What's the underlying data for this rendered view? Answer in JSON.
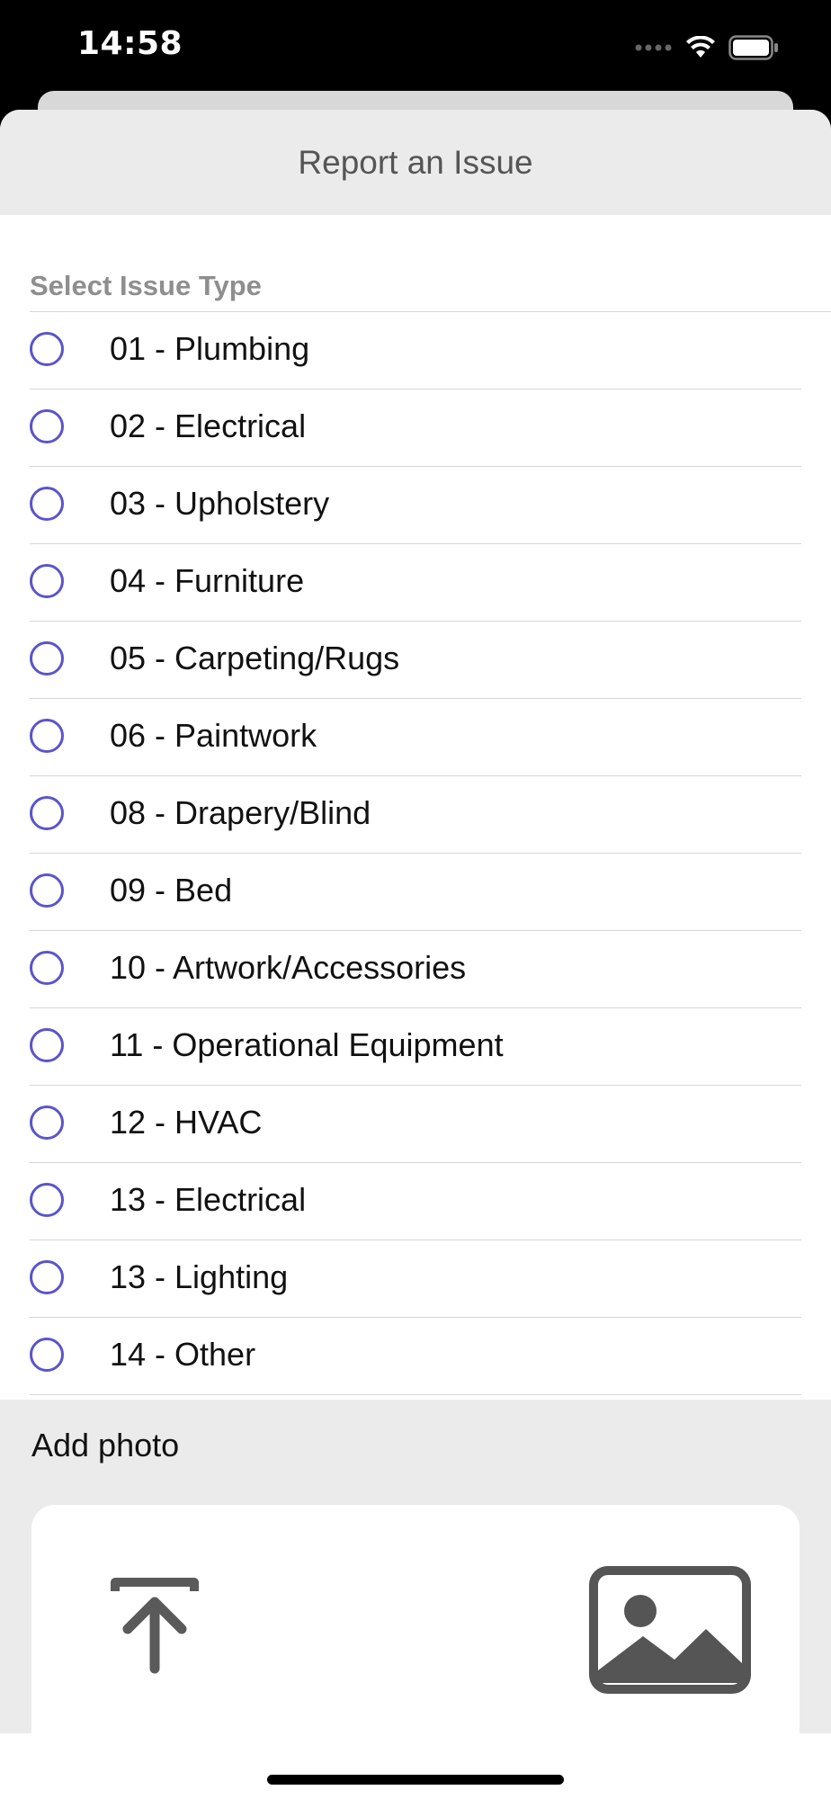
{
  "status_bar": {
    "time": "14:58",
    "icons": [
      "signal-dots-icon",
      "wifi-icon",
      "battery-icon"
    ]
  },
  "sheet": {
    "title": "Report an Issue"
  },
  "issue_types": {
    "section_label": "Select Issue Type",
    "items": [
      {
        "label": "01 - Plumbing",
        "selected": false
      },
      {
        "label": "02 - Electrical",
        "selected": false
      },
      {
        "label": "03 - Upholstery",
        "selected": false
      },
      {
        "label": "04 - Furniture",
        "selected": false
      },
      {
        "label": "05 - Carpeting/Rugs",
        "selected": false
      },
      {
        "label": "06 - Paintwork",
        "selected": false
      },
      {
        "label": "08 - Drapery/Blind",
        "selected": false
      },
      {
        "label": "09 - Bed",
        "selected": false
      },
      {
        "label": "10 - Artwork/Accessories",
        "selected": false
      },
      {
        "label": "11 - Operational Equipment",
        "selected": false
      },
      {
        "label": "12 - HVAC",
        "selected": false
      },
      {
        "label": "13 - Electrical",
        "selected": false
      },
      {
        "label": "13 - Lighting",
        "selected": false
      },
      {
        "label": "14 - Other",
        "selected": false
      }
    ]
  },
  "photo": {
    "label": "Add photo",
    "icons": [
      "upload-icon",
      "image-gallery-icon"
    ]
  },
  "colors": {
    "accent": "#5a54cc",
    "header_bg": "#ebebeb",
    "section_label": "#8e8e8e"
  }
}
